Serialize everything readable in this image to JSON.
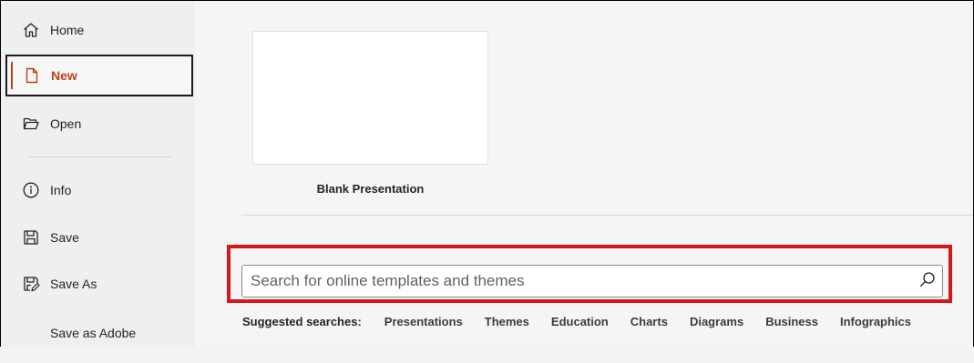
{
  "sidebar": {
    "items": [
      {
        "label": "Home",
        "icon": "home-icon"
      },
      {
        "label": "New",
        "icon": "new-document-icon"
      },
      {
        "label": "Open",
        "icon": "folder-open-icon"
      },
      {
        "label": "Info",
        "icon": "info-icon"
      },
      {
        "label": "Save",
        "icon": "save-icon"
      },
      {
        "label": "Save As",
        "icon": "save-as-icon"
      },
      {
        "label": "Save as Adobe"
      }
    ],
    "selected": "New",
    "accent_color": "#c43e1c"
  },
  "main": {
    "blank_template": {
      "caption": "Blank Presentation"
    },
    "search": {
      "placeholder": "Search for online templates and themes",
      "value": "",
      "highlight_color": "#d9161c"
    },
    "suggested": {
      "lead": "Suggested searches:",
      "links": [
        "Presentations",
        "Themes",
        "Education",
        "Charts",
        "Diagrams",
        "Business",
        "Infographics"
      ]
    }
  }
}
